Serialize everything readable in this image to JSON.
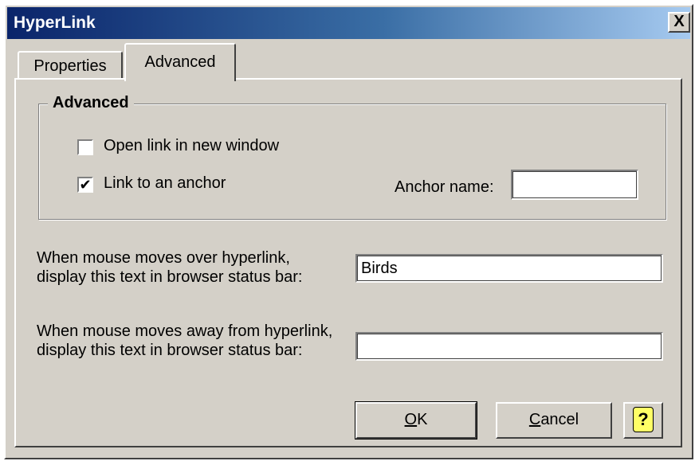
{
  "window": {
    "title": "HyperLink",
    "close_label": "X"
  },
  "tabs": [
    {
      "label": "Properties",
      "active": false
    },
    {
      "label": "Advanced",
      "active": true
    }
  ],
  "advanced_group": {
    "legend": "Advanced",
    "open_new_window": {
      "label": "Open link in new window",
      "checked": false
    },
    "link_to_anchor": {
      "label": "Link to an anchor",
      "checked": true
    },
    "anchor_name": {
      "label": "Anchor name:",
      "value": ""
    }
  },
  "status_over": {
    "label_line1": "When mouse moves over hyperlink,",
    "label_line2": "display this text in browser status bar:",
    "value": "Birds"
  },
  "status_away": {
    "label_line1": "When mouse moves away from hyperlink,",
    "label_line2": "display this text in browser status bar:",
    "value": ""
  },
  "buttons": {
    "ok_mnemonic": "O",
    "ok_rest": "K",
    "cancel_mnemonic": "C",
    "cancel_rest": "ancel",
    "help_glyph": "?"
  },
  "icons": {
    "help": "help-question-icon",
    "close": "close-icon",
    "check": "check-icon"
  },
  "colors": {
    "title_start": "#0a246a",
    "title_end": "#a6caf0",
    "face": "#d4d0c8"
  }
}
